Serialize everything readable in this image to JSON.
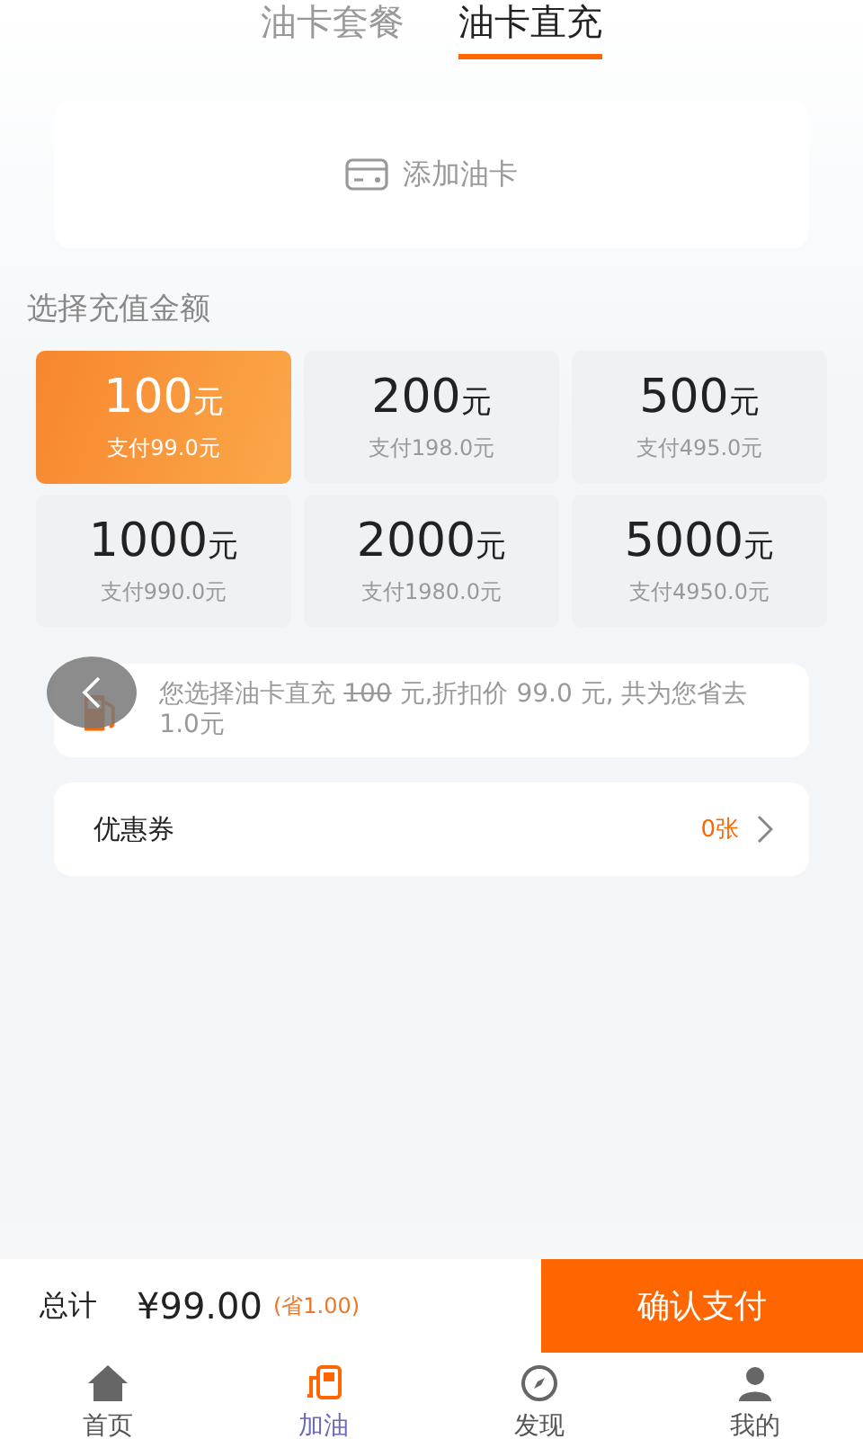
{
  "tabs": [
    {
      "label": "油卡套餐",
      "selected": false
    },
    {
      "label": "油卡直充",
      "selected": true
    }
  ],
  "add_card": {
    "label": "添加油卡"
  },
  "section_title": "选择充值金额",
  "options": [
    {
      "amount": "100",
      "unit": "元",
      "pay": "支付99.0元",
      "selected": true
    },
    {
      "amount": "200",
      "unit": "元",
      "pay": "支付198.0元",
      "selected": false
    },
    {
      "amount": "500",
      "unit": "元",
      "pay": "支付495.0元",
      "selected": false
    },
    {
      "amount": "1000",
      "unit": "元",
      "pay": "支付990.0元",
      "selected": false
    },
    {
      "amount": "2000",
      "unit": "元",
      "pay": "支付1980.0元",
      "selected": false
    },
    {
      "amount": "5000",
      "unit": "元",
      "pay": "支付4950.0元",
      "selected": false
    }
  ],
  "notice": {
    "before": "您选择油卡直充 ",
    "struck": "100",
    "after": " 元,折扣价 99.0 元, 共为您省去 1.0元"
  },
  "coupon": {
    "label": "优惠券",
    "count": "0张"
  },
  "total": {
    "label": "总计",
    "amount": "¥99.00",
    "saving": "(省1.00)"
  },
  "pay_button": "确认支付",
  "nav": [
    {
      "label": "首页",
      "kind": "home",
      "selected": false
    },
    {
      "label": "加油",
      "kind": "fuel",
      "selected": true
    },
    {
      "label": "发现",
      "kind": "discover",
      "selected": false
    },
    {
      "label": "我的",
      "kind": "profile",
      "selected": false
    }
  ]
}
